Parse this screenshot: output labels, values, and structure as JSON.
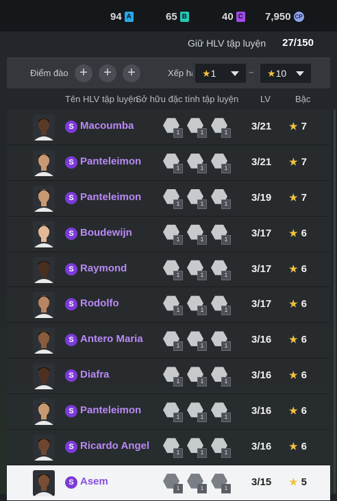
{
  "top": {
    "currencies": [
      {
        "value": "94",
        "letter": "A",
        "color": "#2aa7e8"
      },
      {
        "value": "65",
        "letter": "B",
        "color": "#25c9b4"
      },
      {
        "value": "40",
        "letter": "C",
        "color": "#a24be8"
      }
    ],
    "cp": {
      "value": "7,950",
      "letter": "CP"
    }
  },
  "hold": {
    "label": "Giữ HLV tập luyện",
    "value": "27/150"
  },
  "filter": {
    "points_label": "Điểm đào tạo",
    "rank_label": "Xếp hạng",
    "min_value": "1",
    "separator": "~",
    "max_value": "10",
    "plus": "+"
  },
  "columns": {
    "name": "Tên HLV tập luyện",
    "traits": "Sở hữu đặc tính tập luyện",
    "lv": "LV",
    "grade": "Bậc"
  },
  "rows": [
    {
      "name": "Macoumba",
      "lv": "3/21",
      "grade": "7",
      "skin": "#5a3a26"
    },
    {
      "name": "Panteleimon",
      "lv": "3/21",
      "grade": "7",
      "skin": "#c99a72"
    },
    {
      "name": "Panteleimon",
      "lv": "3/19",
      "grade": "7",
      "skin": "#c99a72"
    },
    {
      "name": "Boudewijn",
      "lv": "3/17",
      "grade": "6",
      "skin": "#e3b897"
    },
    {
      "name": "Raymond",
      "lv": "3/17",
      "grade": "6",
      "skin": "#4a2e20"
    },
    {
      "name": "Rodolfo",
      "lv": "3/17",
      "grade": "6",
      "skin": "#b88562"
    },
    {
      "name": "Antero Maria",
      "lv": "3/16",
      "grade": "6",
      "skin": "#8a5c3c"
    },
    {
      "name": "Diafra",
      "lv": "3/16",
      "grade": "6",
      "skin": "#4e3022"
    },
    {
      "name": "Panteleimon",
      "lv": "3/16",
      "grade": "6",
      "skin": "#c99a72"
    },
    {
      "name": "Ricardo Angel",
      "lv": "3/16",
      "grade": "6",
      "skin": "#6e4630"
    },
    {
      "name": "Asem",
      "lv": "3/15",
      "grade": "5",
      "skin": "#7a4e34"
    }
  ],
  "trait_level": "1",
  "tier_letter": "S",
  "star": "★"
}
